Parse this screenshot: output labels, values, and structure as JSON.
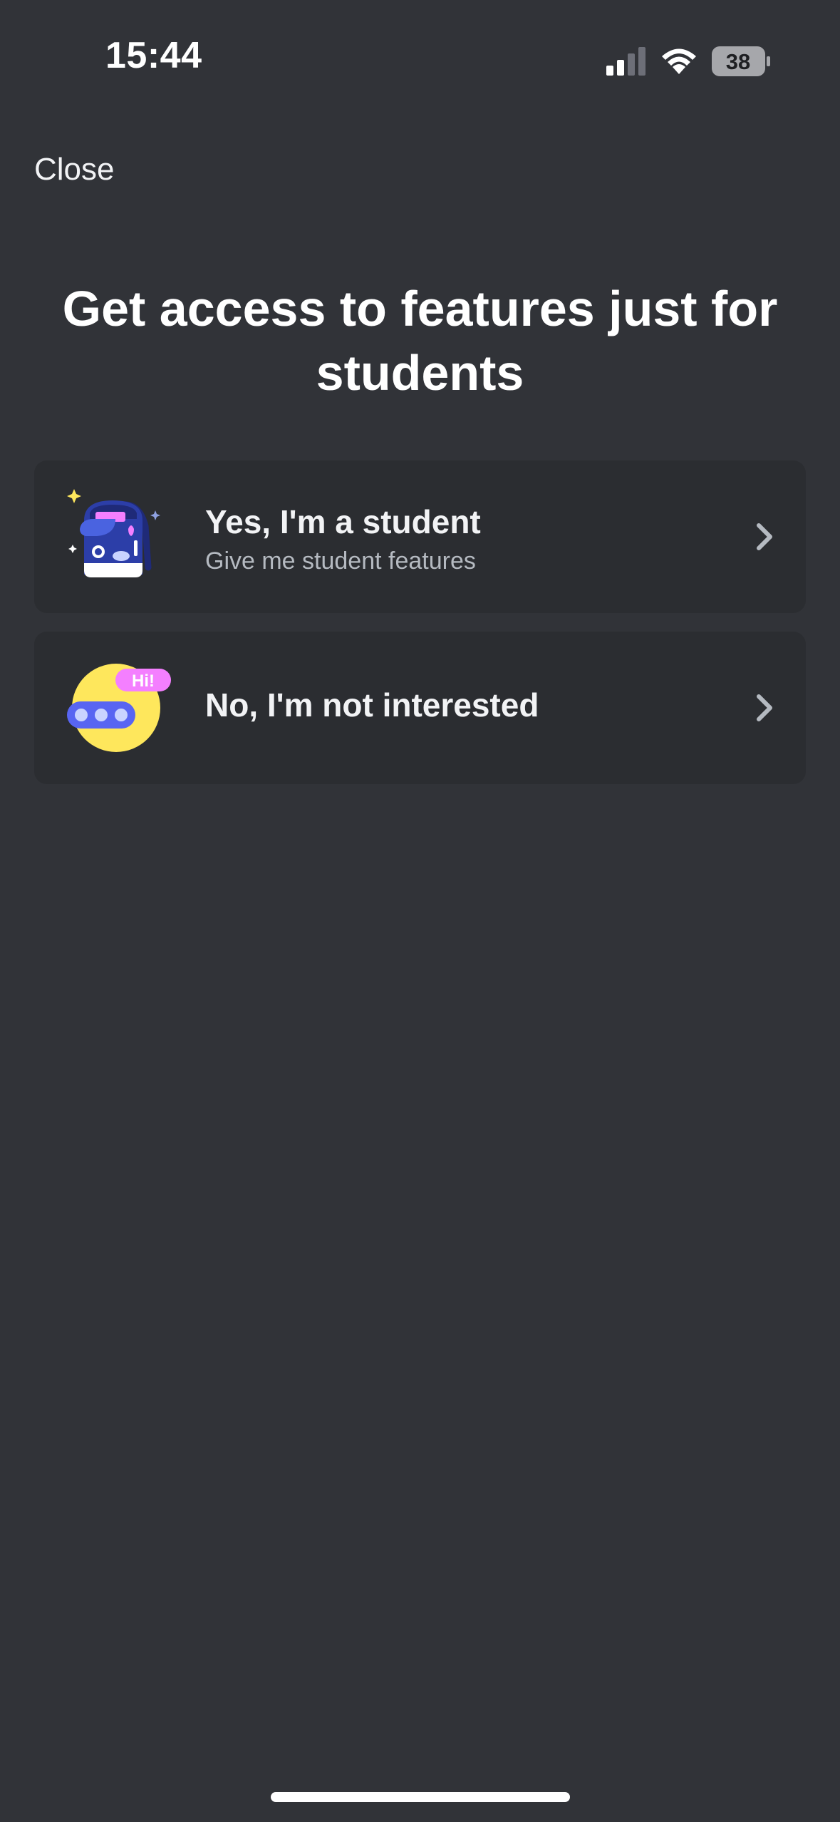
{
  "status_bar": {
    "time": "15:44",
    "battery_level": "38",
    "icons": [
      "signal-icon",
      "wifi-icon",
      "battery-icon"
    ]
  },
  "header": {
    "close_label": "Close"
  },
  "main": {
    "title": "Get access to features just for students",
    "options": [
      {
        "title": "Yes, I'm a student",
        "subtitle": "Give me student features",
        "illustration": "backpack-icon",
        "action_icon": "chevron-right-icon"
      },
      {
        "title": "No, I'm not interested",
        "illustration": "hi-chat-bubble-icon",
        "action_icon": "chevron-right-icon"
      }
    ]
  },
  "colors": {
    "background": "#313338",
    "card": "#2b2d31",
    "text_primary": "#f2f3f5",
    "text_secondary": "#b5bac1",
    "blurple": "#5865f2",
    "pink": "#f47fff",
    "yellow": "#fee75c"
  }
}
